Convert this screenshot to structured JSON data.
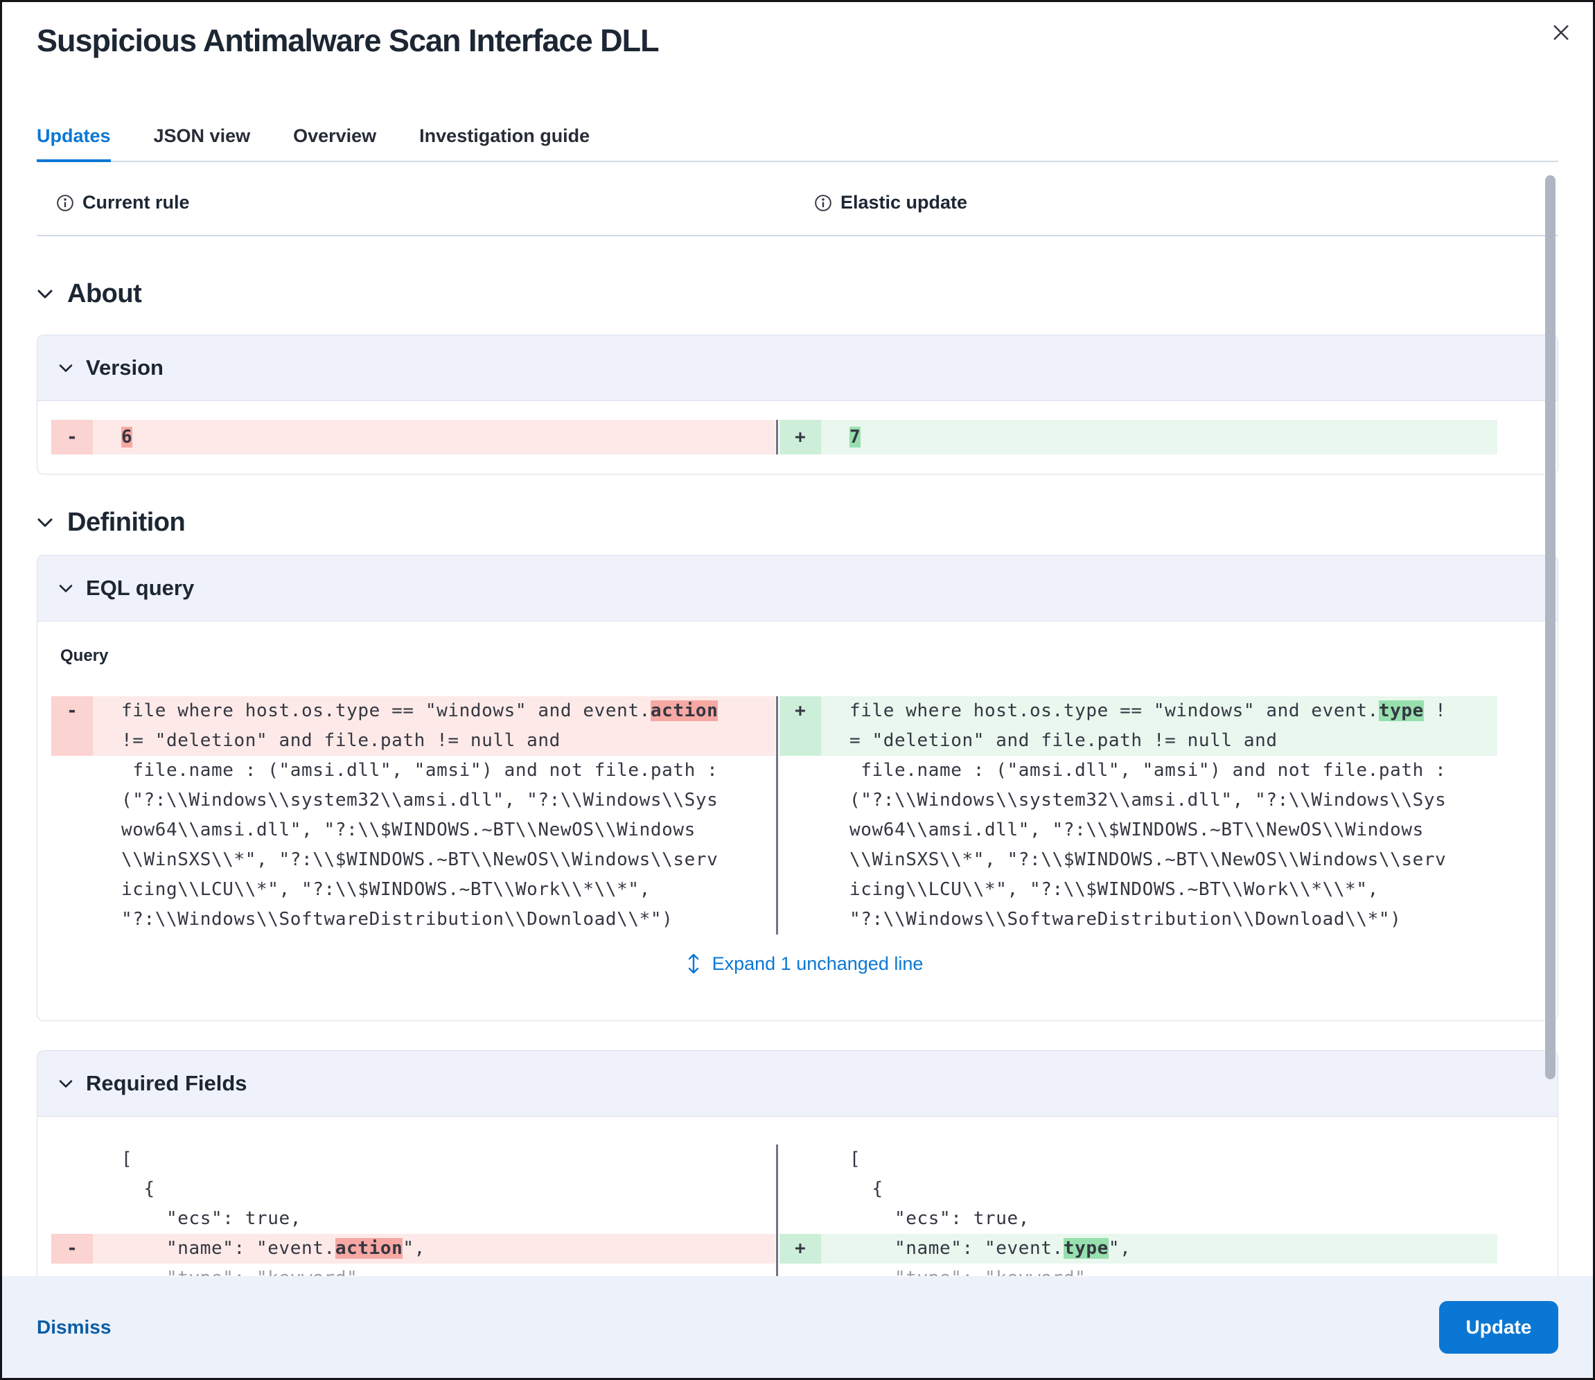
{
  "dialog": {
    "title": "Suspicious Antimalware Scan Interface DLL"
  },
  "tabs": [
    {
      "label": "Updates",
      "active": true
    },
    {
      "label": "JSON view",
      "active": false
    },
    {
      "label": "Overview",
      "active": false
    },
    {
      "label": "Investigation guide",
      "active": false
    }
  ],
  "columns": {
    "current": "Current rule",
    "update": "Elastic update"
  },
  "about": {
    "heading": "About",
    "version": {
      "title": "Version",
      "diff": {
        "left": [
          {
            "k": "rem",
            "g": "-",
            "segs": [
              {
                "t": "6",
                "hl": true
              }
            ]
          }
        ],
        "right": [
          {
            "k": "add",
            "g": "+",
            "segs": [
              {
                "t": "7",
                "hl": true
              }
            ]
          }
        ]
      }
    }
  },
  "definition": {
    "heading": "Definition",
    "eql": {
      "title": "EQL query",
      "query_label": "Query",
      "expand_label": "Expand 1 unchanged line",
      "diff": {
        "left": [
          {
            "k": "rem",
            "g": "-",
            "segs": [
              {
                "t": "file where host.os.type == \"windows\" and event."
              },
              {
                "t": "action",
                "hl": true
              }
            ]
          },
          {
            "k": "rem2",
            "g": "",
            "segs": [
              {
                "t": "!= \"deletion\" and file.path != null and"
              }
            ]
          },
          {
            "k": "ctx",
            "segs": [
              {
                "t": " file.name : (\"amsi.dll\", \"amsi\") and not file.path :"
              }
            ]
          },
          {
            "k": "ctx",
            "segs": [
              {
                "t": "(\"?:\\\\Windows\\\\system32\\\\amsi.dll\", \"?:\\\\Windows\\\\Sys"
              }
            ]
          },
          {
            "k": "ctx",
            "segs": [
              {
                "t": "wow64\\\\amsi.dll\", \"?:\\\\$WINDOWS.~BT\\\\NewOS\\\\Windows"
              }
            ]
          },
          {
            "k": "ctx",
            "segs": [
              {
                "t": "\\\\WinSXS\\\\*\", \"?:\\\\$WINDOWS.~BT\\\\NewOS\\\\Windows\\\\serv"
              }
            ]
          },
          {
            "k": "ctx",
            "segs": [
              {
                "t": "icing\\\\LCU\\\\*\", \"?:\\\\$WINDOWS.~BT\\\\Work\\\\*\\\\*\","
              }
            ]
          },
          {
            "k": "ctx",
            "segs": [
              {
                "t": "\"?:\\\\Windows\\\\SoftwareDistribution\\\\Download\\\\*\")"
              }
            ]
          }
        ],
        "right": [
          {
            "k": "add",
            "g": "+",
            "segs": [
              {
                "t": "file where host.os.type == \"windows\" and event."
              },
              {
                "t": "type",
                "hl": true
              },
              {
                "t": " !"
              }
            ]
          },
          {
            "k": "add2",
            "g": "",
            "segs": [
              {
                "t": "= \"deletion\" and file.path != null and"
              }
            ]
          },
          {
            "k": "ctx",
            "segs": [
              {
                "t": " file.name : (\"amsi.dll\", \"amsi\") and not file.path :"
              }
            ]
          },
          {
            "k": "ctx",
            "segs": [
              {
                "t": "(\"?:\\\\Windows\\\\system32\\\\amsi.dll\", \"?:\\\\Windows\\\\Sys"
              }
            ]
          },
          {
            "k": "ctx",
            "segs": [
              {
                "t": "wow64\\\\amsi.dll\", \"?:\\\\$WINDOWS.~BT\\\\NewOS\\\\Windows"
              }
            ]
          },
          {
            "k": "ctx",
            "segs": [
              {
                "t": "\\\\WinSXS\\\\*\", \"?:\\\\$WINDOWS.~BT\\\\NewOS\\\\Windows\\\\serv"
              }
            ]
          },
          {
            "k": "ctx",
            "segs": [
              {
                "t": "icing\\\\LCU\\\\*\", \"?:\\\\$WINDOWS.~BT\\\\Work\\\\*\\\\*\","
              }
            ]
          },
          {
            "k": "ctx",
            "segs": [
              {
                "t": "\"?:\\\\Windows\\\\SoftwareDistribution\\\\Download\\\\*\")"
              }
            ]
          }
        ]
      }
    },
    "required_fields": {
      "title": "Required Fields",
      "diff": {
        "left": [
          {
            "k": "ctx",
            "segs": [
              {
                "t": "["
              }
            ]
          },
          {
            "k": "ctx",
            "segs": [
              {
                "t": "  {"
              }
            ]
          },
          {
            "k": "ctx",
            "segs": [
              {
                "t": "    \"ecs\": true,"
              }
            ]
          },
          {
            "k": "rem",
            "g": "-",
            "segs": [
              {
                "t": "    \"name\": \"event."
              },
              {
                "t": "action",
                "hl": true
              },
              {
                "t": "\","
              }
            ]
          },
          {
            "k": "ctx",
            "fade": true,
            "segs": [
              {
                "t": "    \"type\": \"keyword\""
              }
            ]
          }
        ],
        "right": [
          {
            "k": "ctx",
            "segs": [
              {
                "t": "["
              }
            ]
          },
          {
            "k": "ctx",
            "segs": [
              {
                "t": "  {"
              }
            ]
          },
          {
            "k": "ctx",
            "segs": [
              {
                "t": "    \"ecs\": true,"
              }
            ]
          },
          {
            "k": "add",
            "g": "+",
            "segs": [
              {
                "t": "    \"name\": \"event."
              },
              {
                "t": "type",
                "hl": true
              },
              {
                "t": "\","
              }
            ]
          },
          {
            "k": "ctx",
            "fade": true,
            "segs": [
              {
                "t": "    \"type\": \"keyword\""
              }
            ]
          }
        ]
      }
    }
  },
  "footer": {
    "dismiss": "Dismiss",
    "update": "Update"
  },
  "colors": {
    "accent": "#0b77d4",
    "dismiss_text": "#0a5da6",
    "removed_bg": "#fdeae8",
    "removed_highlight": "#f7a8a3",
    "added_bg": "#e9f7ee",
    "added_highlight": "#97e0ae"
  }
}
